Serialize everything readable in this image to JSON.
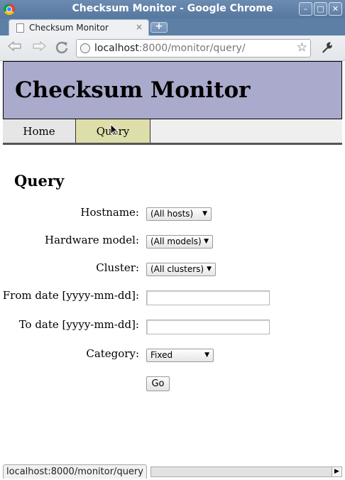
{
  "window": {
    "title": "Checksum Monitor - Google Chrome",
    "controls": [
      "–",
      "□",
      "✕"
    ]
  },
  "tab": {
    "title": "Checksum Monitor",
    "close": "×",
    "new_tab": "+"
  },
  "toolbar": {
    "url_host": "localhost",
    "url_rest": ":8000/monitor/query/"
  },
  "page": {
    "site_title": "Checksum Monitor",
    "nav": {
      "home": "Home",
      "query": "Query"
    },
    "heading": "Query",
    "form": {
      "hostname_label": "Hostname:",
      "hostname_value": "(All hosts)",
      "model_label": "Hardware model:",
      "model_value": "(All models)",
      "cluster_label": "Cluster:",
      "cluster_value": "(All clusters)",
      "from_label": "From date [yyyy-mm-dd]:",
      "from_value": "",
      "to_label": "To date [yyyy-mm-dd]:",
      "to_value": "",
      "category_label": "Category:",
      "category_value": "Fixed",
      "submit_label": "Go"
    }
  },
  "status": {
    "text": "localhost:8000/monitor/query"
  },
  "colors": {
    "header_bg": "#aaaacc",
    "active_nav_bg": "#dddeaa",
    "chrome_frame": "#5d7fa6"
  }
}
